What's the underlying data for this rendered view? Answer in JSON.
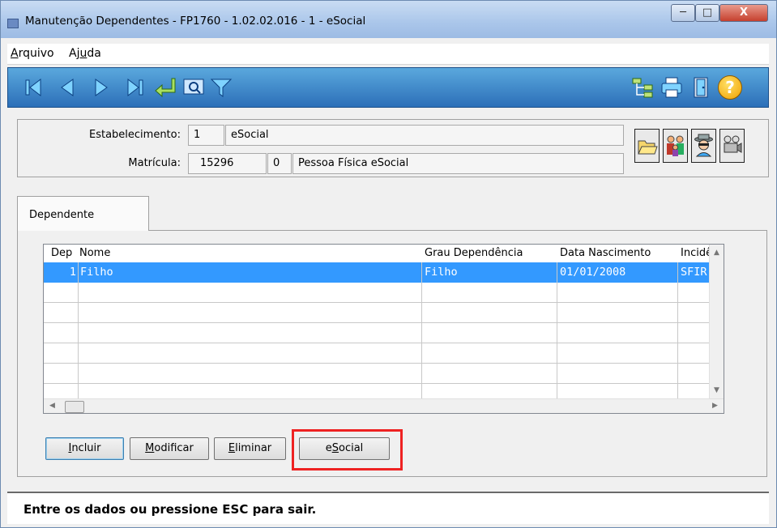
{
  "window": {
    "title": "Manutenção Dependentes - FP1760 - 1.02.02.016 - 1 - eSocial",
    "controls": {
      "minimize": "─",
      "maximize": "□",
      "close": "X"
    }
  },
  "menu": {
    "arquivo_first": "A",
    "arquivo_rest": "rquivo",
    "ajuda_first": "Aj",
    "ajuda_mid": "u",
    "ajuda_rest": "da"
  },
  "toolbar": {
    "icons_left": [
      "first-record-icon",
      "previous-record-icon",
      "next-record-icon",
      "last-record-icon",
      "goto-return-icon",
      "search-screen-icon",
      "filter-icon"
    ],
    "icons_right": [
      "tree-structure-icon",
      "print-icon",
      "exit-door-icon",
      "help-icon"
    ],
    "help_glyph": "?"
  },
  "header": {
    "estabelecimento_label": "Estabelecimento:",
    "estabelecimento_code": "1",
    "estabelecimento_name": "eSocial",
    "matricula_label": "Matrícula:",
    "matricula_value": "15296",
    "matricula_digit": "0",
    "matricula_name": "Pessoa Física eSocial"
  },
  "tab": {
    "label": "Dependente"
  },
  "grid": {
    "columns": [
      "Dep",
      "Nome",
      "Grau Dependência",
      "Data Nascimento",
      "Incidên"
    ],
    "rows": [
      {
        "dep": "1",
        "nome": "Filho",
        "grau": "Filho",
        "data": "01/01/2008",
        "incid": "SFIR"
      }
    ]
  },
  "buttons": {
    "incluir_first": "I",
    "incluir_rest": "ncluir",
    "modificar_first": "M",
    "modificar_rest": "odificar",
    "eliminar_first": "E",
    "eliminar_rest": "liminar",
    "esocial_pre": "e",
    "esocial_ul": "S",
    "esocial_rest": "ocial"
  },
  "status": {
    "text": "Entre os dados ou pressione ESC para sair."
  },
  "colors": {
    "toolbar": "#2c6fb8",
    "selected_row": "#3399ff",
    "highlight": "#ee2222"
  }
}
